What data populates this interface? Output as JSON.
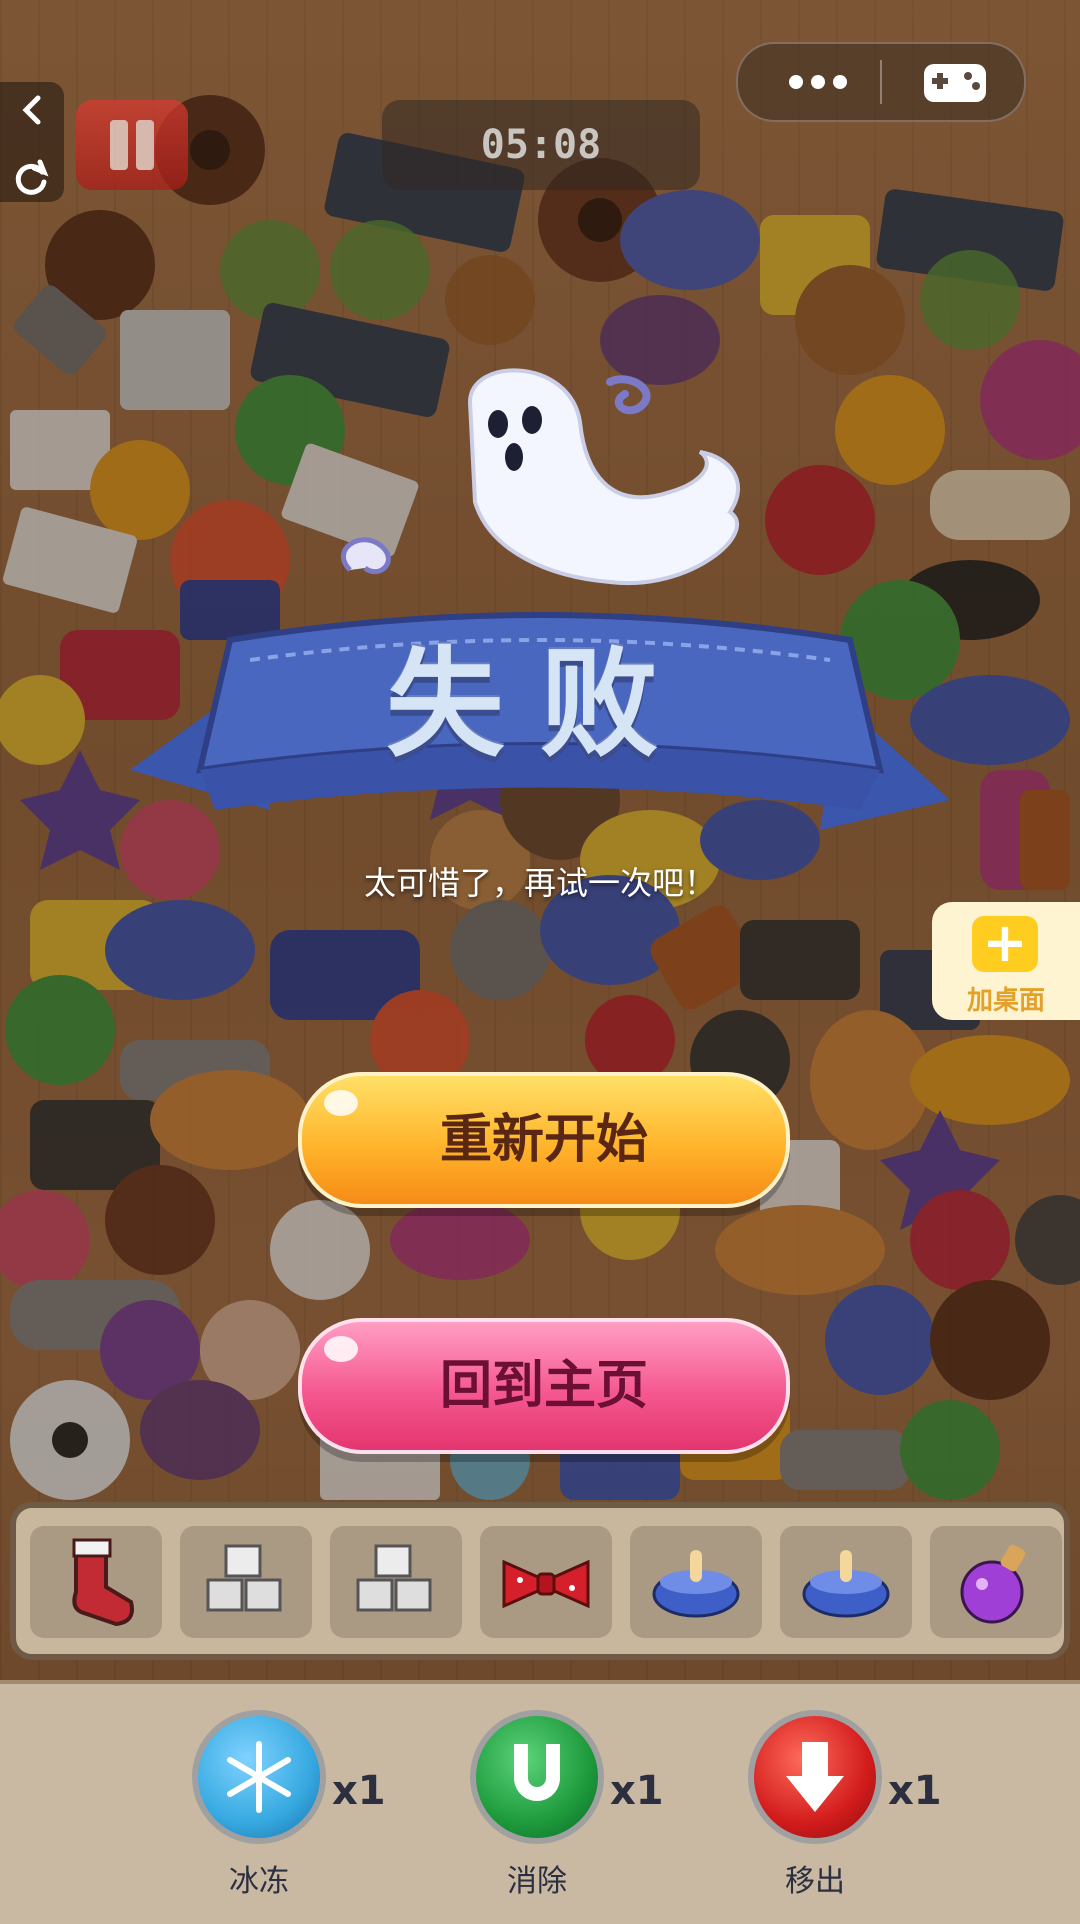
{
  "timer": "05:08",
  "result_title": "失败",
  "result_subtitle": "太可惜了，再试一次吧！",
  "buttons": {
    "restart": "重新开始",
    "home": "回到主页"
  },
  "add_to_desktop": "加桌面",
  "tray_items": [
    "stocking-icon",
    "sugar-cubes-icon",
    "sugar-cubes-icon",
    "bow-tie-icon",
    "pet-bowl-icon",
    "pet-bowl-icon",
    "potion-icon"
  ],
  "powerups": [
    {
      "name": "冰冻",
      "count": "x1",
      "icon": "snowflake-icon",
      "color": "#36a9e0"
    },
    {
      "name": "消除",
      "count": "x1",
      "icon": "magnet-icon",
      "color": "#1e9a3c"
    },
    {
      "name": "移出",
      "count": "x1",
      "icon": "down-arrow-icon",
      "color": "#d21c1c"
    }
  ],
  "colors": {
    "restart_button": "#ffb42b",
    "home_button": "#f5588f",
    "banner": "#4a63b3"
  }
}
